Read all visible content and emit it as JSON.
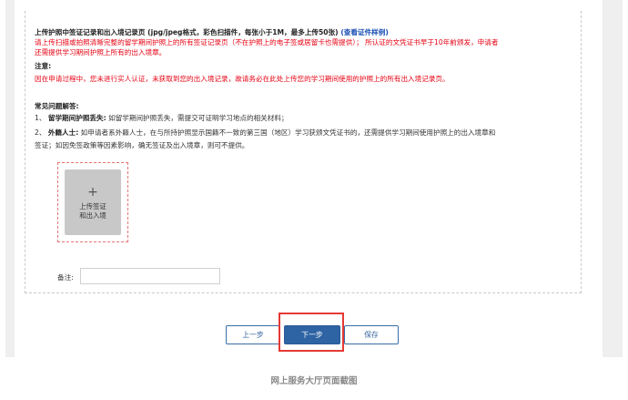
{
  "upload_section": {
    "heading_main": "上传护照中签证记录和出入境记录页 (jpg/jpeg格式，彩色扫描件，每张小于1M，最多上传50张)",
    "heading_link": "(查看证件样例)",
    "red_line_1": "请上传扫描或拍照清晰完整的留学期间护照上的所有签证记录页（不在护照上的电子签或居留卡也需提供）； 所认证的文凭证书早于10年前颁发，申请者",
    "red_line_2": "还需提供学习期间护照上所有的出入境章。",
    "notice_label": "注意:",
    "notice_text": "因在申请过程中，您未进行实人认证，未获取到您的出入境记录，故请务必在此处上传您的学习期间使用的护照上的所有出入境记录页。"
  },
  "faq": {
    "title": "常见问题解答:",
    "item1_prefix": "1、",
    "item1_bold": "留学期间护照丢失:",
    "item1_text": "如留学期间护照丢失，需提交可证明学习地点的相关材料；",
    "item2_prefix": "2、",
    "item2_bold": "外籍人士:",
    "item2_text": "如申请者系外籍人士，在与所持护照显示国籍不一致的第三国（地区）学习获颁文凭证书的，还需提供学习期间使用护照上的出入境章和",
    "item2_text_cont": "签证；如因免签政策等因素影响，确无签证及出入境章，则可不提供。"
  },
  "upload_button": {
    "plus": "+",
    "line1": "上传签证",
    "line2": "和出入境"
  },
  "remark": {
    "label": "备注:",
    "value": ""
  },
  "nav": {
    "prev_label": "上一步",
    "next_label": "下一步",
    "save_label": "保存"
  },
  "caption": "网上服务大厅页面截图",
  "colors": {
    "primary_button": "#2e63a4",
    "warning_text": "#e60012",
    "highlight_box": "#e53935"
  }
}
